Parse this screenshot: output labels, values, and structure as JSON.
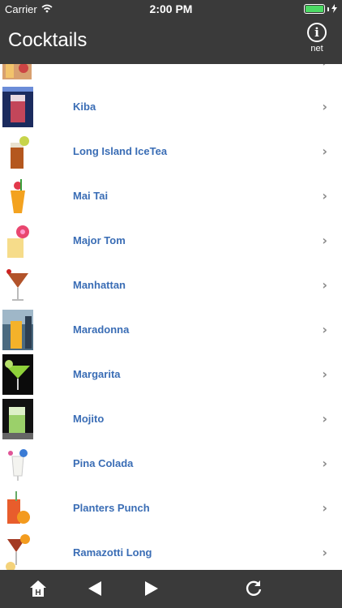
{
  "status_bar": {
    "carrier": "Carrier",
    "time": "2:00 PM",
    "battery_color": "#4cd964"
  },
  "nav": {
    "title": "Cocktails",
    "info_glyph": "i",
    "info_label": "net"
  },
  "rows": [
    {
      "label": "",
      "icon": "cocktail-thumbnail-icon"
    },
    {
      "label": "Kiba",
      "icon": "cocktail-thumbnail-icon"
    },
    {
      "label": "Long Island IceTea",
      "icon": "cocktail-thumbnail-icon"
    },
    {
      "label": "Mai Tai",
      "icon": "cocktail-thumbnail-icon"
    },
    {
      "label": "Major Tom",
      "icon": "cocktail-thumbnail-icon"
    },
    {
      "label": "Manhattan",
      "icon": "cocktail-thumbnail-icon"
    },
    {
      "label": "Maradonna",
      "icon": "cocktail-thumbnail-icon"
    },
    {
      "label": "Margarita",
      "icon": "cocktail-thumbnail-icon"
    },
    {
      "label": "Mojito",
      "icon": "cocktail-thumbnail-icon"
    },
    {
      "label": "Pina Colada",
      "icon": "cocktail-thumbnail-icon"
    },
    {
      "label": "Planters Punch",
      "icon": "cocktail-thumbnail-icon"
    },
    {
      "label": "Ramazotti Long",
      "icon": "cocktail-thumbnail-icon"
    }
  ],
  "colors": {
    "bar_background": "#3a3a3a",
    "row_text": "#3a6db5",
    "chevron": "#8a8a8a"
  },
  "toolbar": {
    "home_label": "H",
    "icons": [
      "home-icon",
      "back-arrow-icon",
      "forward-arrow-icon",
      "reload-icon"
    ]
  }
}
